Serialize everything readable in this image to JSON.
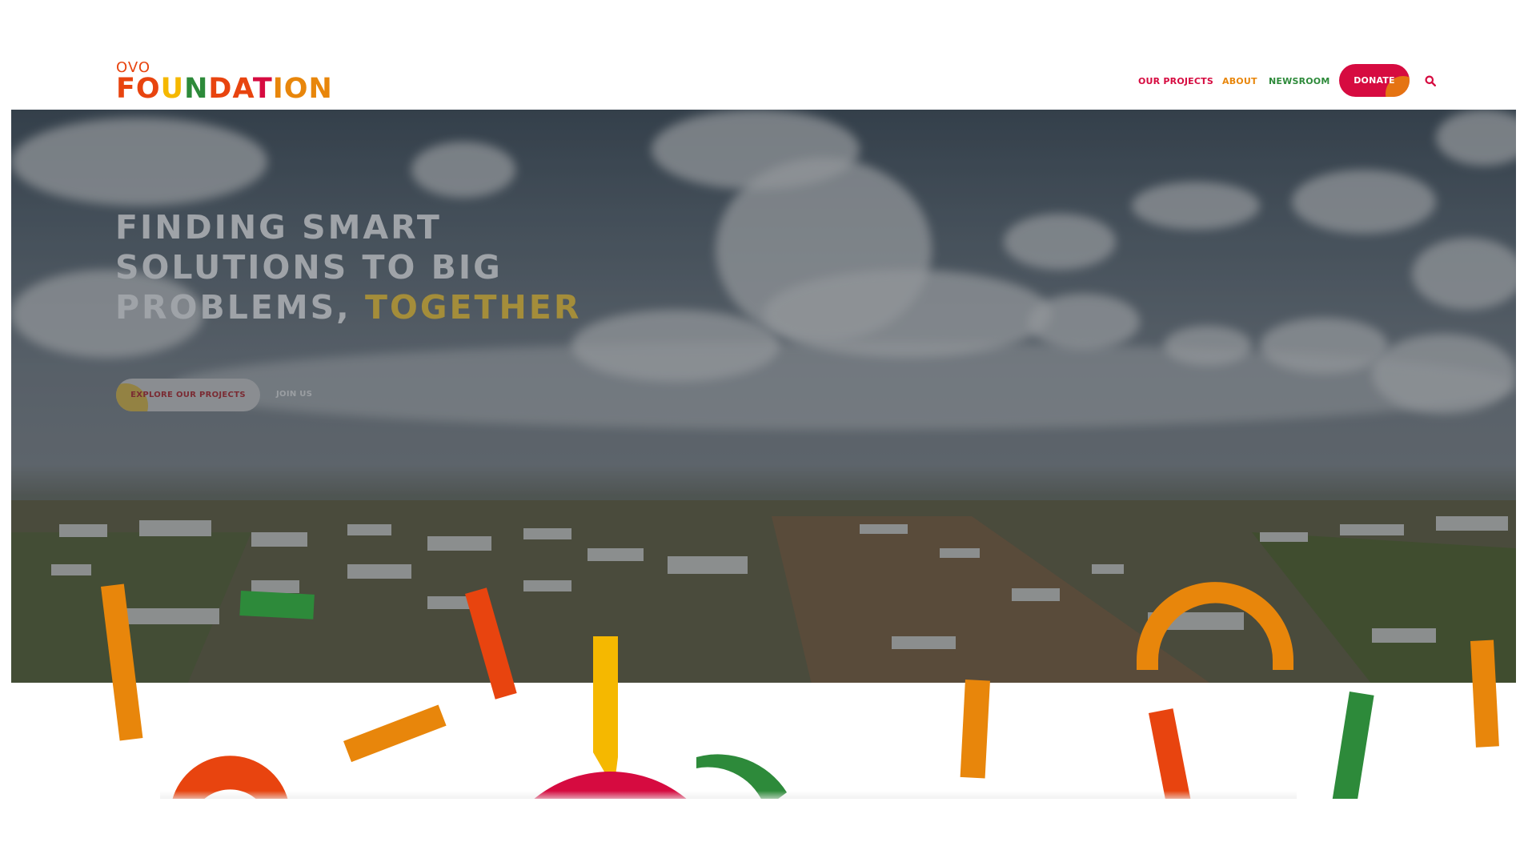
{
  "logo": {
    "line1": "OVO",
    "line2_parts": [
      "FO",
      "U",
      "N",
      "DA",
      "T",
      "ION"
    ]
  },
  "nav": {
    "projects": "OUR PROJECTS",
    "about": "ABOUT",
    "newsroom": "NEWSROOM",
    "donate": "DONATE"
  },
  "hero": {
    "title_main": "FINDING SMART SOLUTIONS TO BIG PROBLEMS, ",
    "title_highlight": "TOGETHER",
    "cta_primary": "EXPLORE OUR PROJECTS",
    "cta_secondary": "JOIN US"
  },
  "icons": {
    "search": "search-icon"
  },
  "colors": {
    "brand_red": "#d60b40",
    "brand_orange": "#e8860b",
    "brand_green": "#2d8a3a",
    "brand_yellow": "#f5b800",
    "brand_vermilion": "#e8440f"
  }
}
